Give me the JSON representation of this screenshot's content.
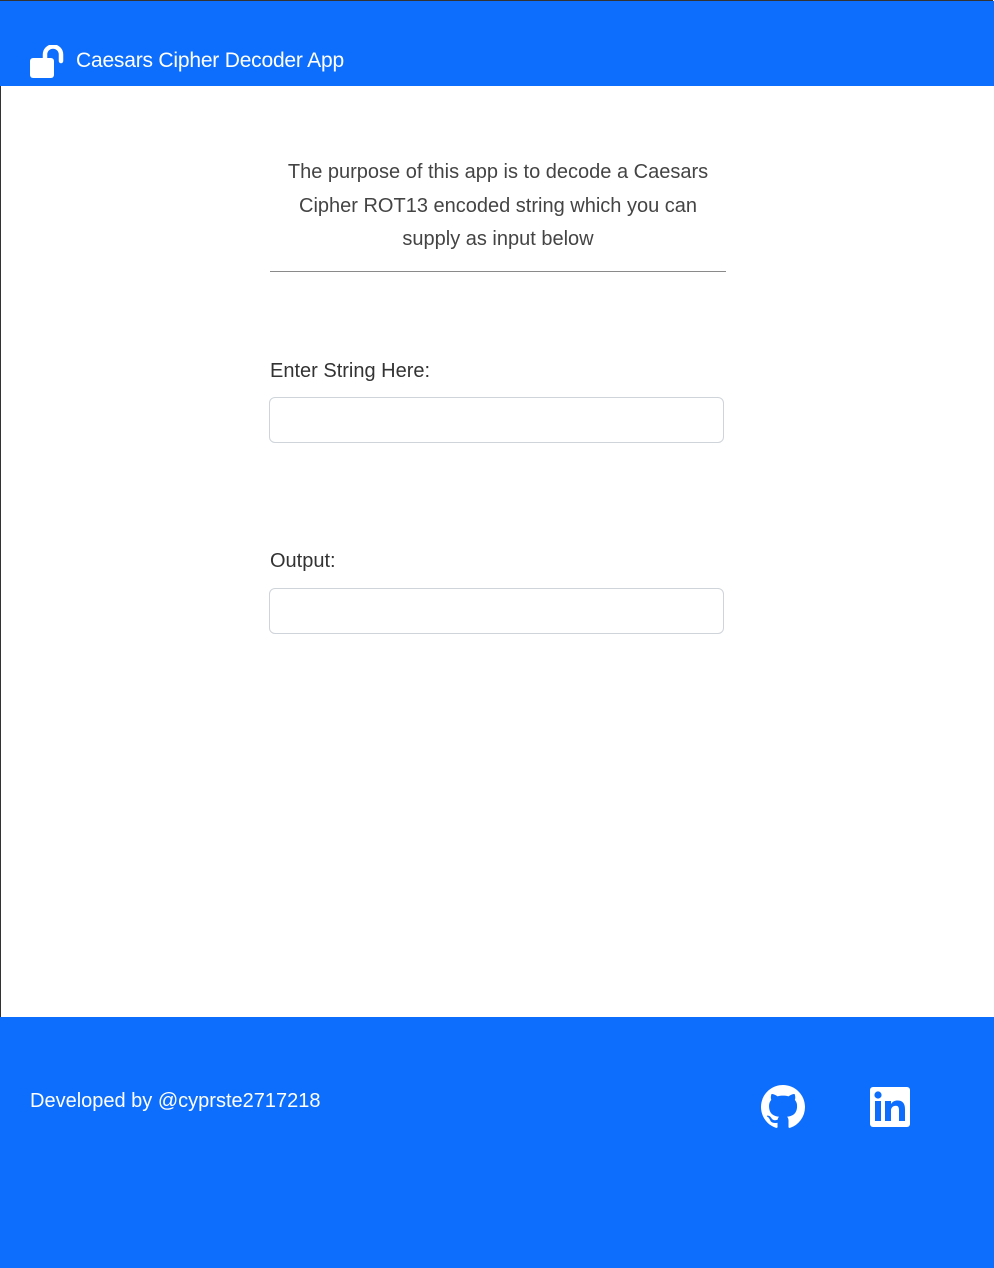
{
  "header": {
    "title": "Caesars Cipher Decoder App",
    "icon": "unlock-icon",
    "background_color": "#0d6efd"
  },
  "main": {
    "description": "The purpose of this app is to decode a Caesars Cipher ROT13 encoded string which you can supply as input below",
    "input": {
      "label": "Enter String Here:",
      "value": "",
      "placeholder": ""
    },
    "output": {
      "label": "Output:",
      "value": "",
      "placeholder": ""
    }
  },
  "footer": {
    "credit": "Developed by @cyprste2717218",
    "background_color": "#0d6efd",
    "links": [
      {
        "name": "github",
        "icon": "github-icon"
      },
      {
        "name": "linkedin",
        "icon": "linkedin-icon"
      }
    ]
  }
}
